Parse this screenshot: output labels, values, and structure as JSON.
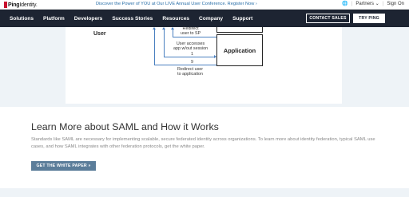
{
  "header": {
    "logo_brand": "Ping",
    "logo_suffix": "Identity.",
    "announcement": "Discover the Power of YOU at Our LIVE Annual User Conference. Register Now",
    "announcement_arrow": "›",
    "utility": {
      "globe_icon": "globe-icon",
      "partners_label": "Partners",
      "partners_chevron": "⌄",
      "signin_label": "Sign On"
    }
  },
  "nav": {
    "items": [
      {
        "label": "Solutions"
      },
      {
        "label": "Platform"
      },
      {
        "label": "Developers"
      },
      {
        "label": "Success Stories"
      },
      {
        "label": "Resources"
      },
      {
        "label": "Company"
      },
      {
        "label": "Support"
      }
    ],
    "contact_label": "CONTACT SALES",
    "try_label": "TRY PING"
  },
  "diagram": {
    "user_label": "User",
    "redirect_top": "Redirect\nuser to SP",
    "access_label": "User accesses\napp w/out session",
    "step1": "1",
    "step9": "9",
    "redirect_bottom": "Redirect user\nto application",
    "app_label": "Application",
    "colors": {
      "arrow": "#4a80c0"
    }
  },
  "learn_more": {
    "title": "Learn More about SAML and How it Works",
    "body": "Standards like SAML are necessary for implementing scalable, secure federated identity across organizations. To learn more about identity federation, typical SAML use cases, and how SAML integrates with other federation protocols, get the white paper.",
    "button_label": "GET THE WHITE PAPER »"
  },
  "colors": {
    "nav_bg": "#1d2432",
    "brand_red": "#c8102e",
    "band_bg": "#eef3f7",
    "button_bg": "#5b7d9a",
    "link_blue": "#2a6fa8"
  }
}
